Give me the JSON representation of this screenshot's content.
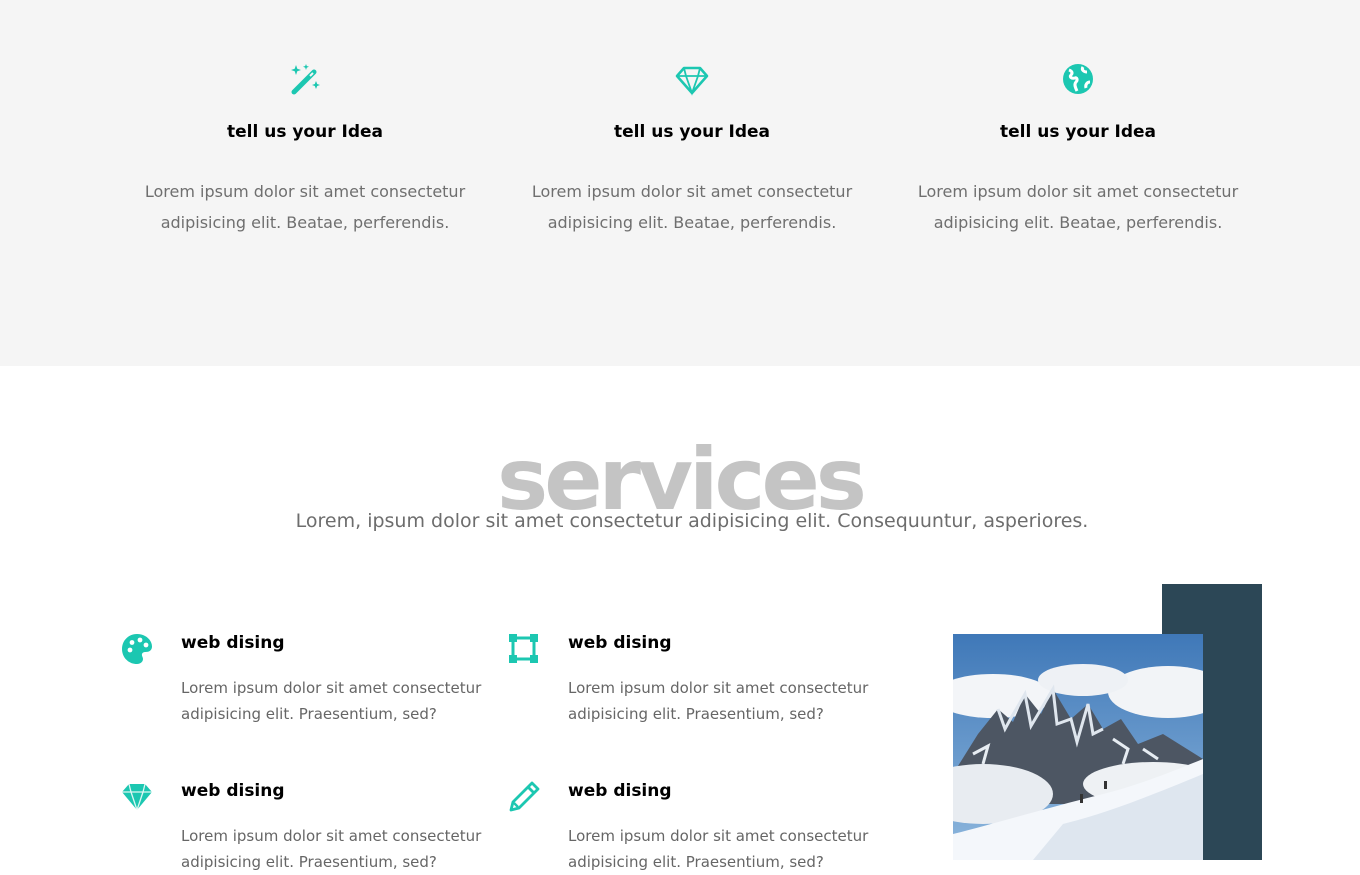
{
  "features": [
    {
      "icon": "magic-wand-icon",
      "title": "tell us your Idea",
      "text": "Lorem ipsum dolor sit amet consectetur adipisicing elit. Beatae, perferendis."
    },
    {
      "icon": "diamond-icon",
      "title": "tell us your Idea",
      "text": "Lorem ipsum dolor sit amet consectetur adipisicing elit. Beatae, perferendis."
    },
    {
      "icon": "globe-icon",
      "title": "tell us your Idea",
      "text": "Lorem ipsum dolor sit amet consectetur adipisicing elit. Beatae, perferendis."
    }
  ],
  "services": {
    "title": "services",
    "subtitle": "Lorem, ipsum dolor sit amet consectetur adipisicing elit. Consequuntur, asperiores.",
    "items": [
      {
        "icon": "palette-icon",
        "title": "web dising",
        "text": "Lorem ipsum dolor sit amet consectetur adipisicing elit. Praesentium, sed?"
      },
      {
        "icon": "vector-square-icon",
        "title": "web dising",
        "text": "Lorem ipsum dolor sit amet consectetur adipisicing elit. Praesentium, sed?"
      },
      {
        "icon": "gem-icon",
        "title": "web dising",
        "text": "Lorem ipsum dolor sit amet consectetur adipisicing elit. Praesentium, sed?"
      },
      {
        "icon": "pencil-icon",
        "title": "web dising",
        "text": "Lorem ipsum dolor sit amet consectetur adipisicing elit. Praesentium, sed?"
      }
    ]
  },
  "image": {
    "alt": "mountain-photo"
  },
  "colors": {
    "accent": "#1cc7b1",
    "navy": "#2c4756",
    "section_bg": "#f5f5f5",
    "title_gray": "#c4c4c4"
  }
}
